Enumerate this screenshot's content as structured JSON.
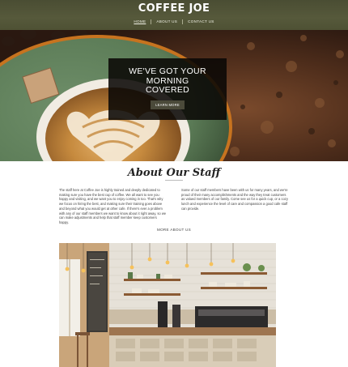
{
  "header": {
    "brand": "COFFEE JOE",
    "nav": [
      {
        "label": "HOME",
        "active": true
      },
      {
        "label": "ABOUT US",
        "active": false
      },
      {
        "label": "CONTACT US",
        "active": false
      }
    ],
    "background_color": "#52553a"
  },
  "hero": {
    "title_lines": [
      "WE'VE GOT YOUR",
      "MORNING",
      "COVERED"
    ],
    "button_label": "LEARN MORE"
  },
  "about": {
    "title": "About Our Staff",
    "paragraph_left": "The staff here at Coffee Joe is highly trained and deeply dedicated to making sure you have the best cup of coffee. We all want to see you happy and visiting, and we want you to enjoy coming in too. That's why we focus on hiring the best, and making sure their training goes above and beyond what you would get at other cafe. If there's ever a problem with any of our staff members we want to know about it right away, so we can make adjustments and help that staff member keep customers happy.",
    "paragraph_right": "Some of our staff members have been with us for many years, and we're proud of their many accomplishments and the way they treat customers as valued members of our family. Come see us for a quick cup, or a cozy lunch and experience the level of care and compassion a good cafe staff can provide.",
    "more_link": "MORE ABOUT US"
  }
}
